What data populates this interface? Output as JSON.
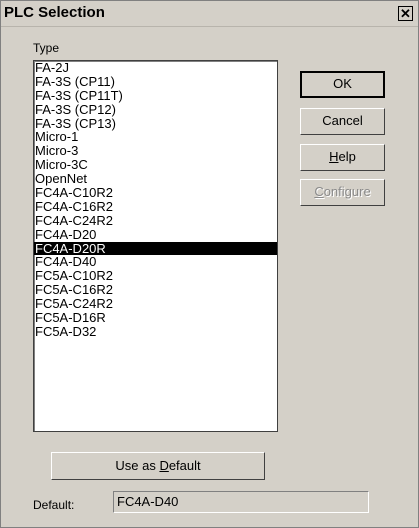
{
  "window": {
    "title": "PLC Selection",
    "close_glyph": "✕"
  },
  "type_label": "Type",
  "list": {
    "items": [
      "FA-2J",
      "FA-3S (CP11)",
      "FA-3S (CP11T)",
      "FA-3S (CP12)",
      "FA-3S (CP13)",
      "Micro-1",
      "Micro-3",
      "Micro-3C",
      "OpenNet",
      "FC4A-C10R2",
      "FC4A-C16R2",
      "FC4A-C24R2",
      "FC4A-D20",
      "FC4A-D20R",
      "FC4A-D40",
      "FC5A-C10R2",
      "FC5A-C16R2",
      "FC5A-C24R2",
      "FC5A-D16R",
      "FC5A-D32"
    ],
    "selected": "FC4A-D20R"
  },
  "buttons": {
    "ok": "OK",
    "cancel": "Cancel",
    "help_mnemonic": "H",
    "help_rest": "elp",
    "configure_mnemonic": "C",
    "configure_rest": "onfigure"
  },
  "use_default": {
    "prefix": "Use as ",
    "mnemonic": "D",
    "rest": "efault"
  },
  "default": {
    "label": "Default:",
    "value": "FC4A-D40"
  }
}
